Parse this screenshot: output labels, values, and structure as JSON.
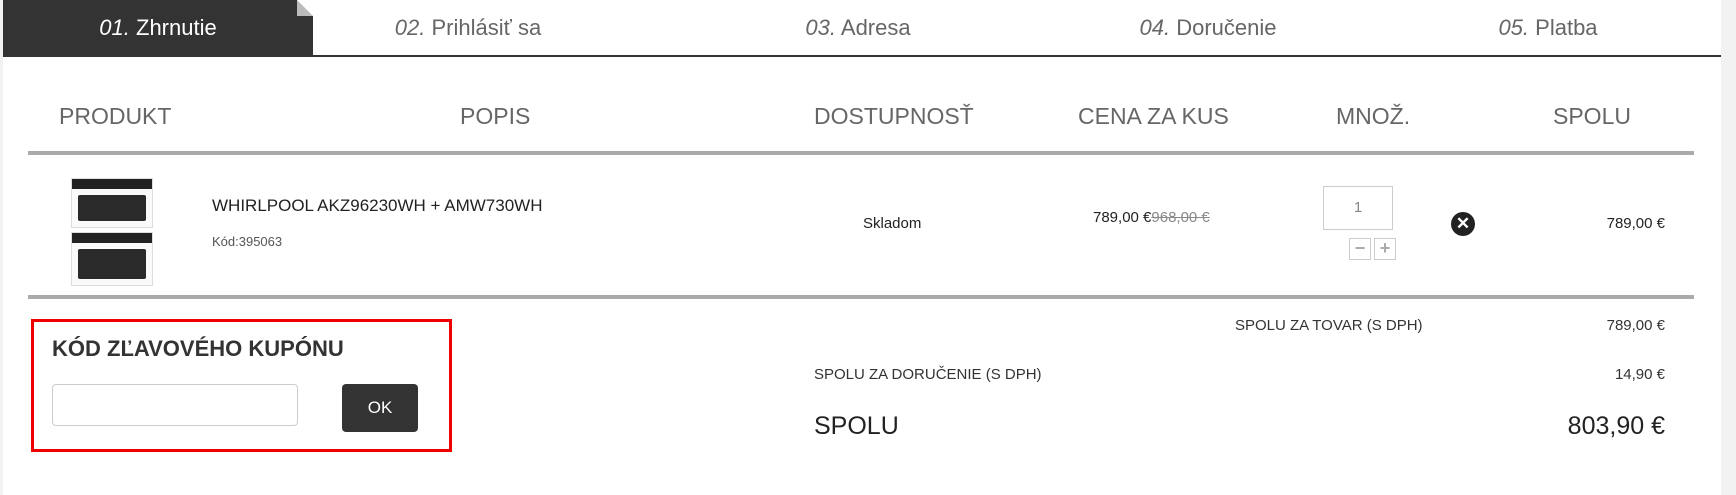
{
  "steps": [
    {
      "num": "01.",
      "label": "Zhrnutie"
    },
    {
      "num": "02.",
      "label": "Prihlásiť sa"
    },
    {
      "num": "03.",
      "label": "Adresa"
    },
    {
      "num": "04.",
      "label": "Doručenie"
    },
    {
      "num": "05.",
      "label": "Platba"
    }
  ],
  "table": {
    "headers": {
      "product": "PRODUKT",
      "description": "POPIS",
      "availability": "DOSTUPNOSŤ",
      "unit_price": "CENA ZA KUS",
      "quantity": "MNOŽ.",
      "total": "SPOLU"
    },
    "row": {
      "name": "WHIRLPOOL AKZ96230WH + AMW730WH",
      "code": "Kód:395063",
      "availability": "Skladom",
      "price": "789,00 €",
      "old_price": "968,00 €",
      "quantity": "1",
      "qty_minus": "−",
      "qty_plus": "+",
      "remove": "✕",
      "total": "789,00 €"
    }
  },
  "coupon": {
    "title": "KÓD ZĽAVOVÉHO KUPÓNU",
    "input_value": "",
    "button": "OK"
  },
  "totals": {
    "goods_label": "SPOLU ZA TOVAR (S DPH)",
    "goods_value": "789,00 €",
    "delivery_label": "SPOLU ZA DORUČENIE (S DPH)",
    "delivery_value": "14,90 €",
    "grand_label": "SPOLU",
    "grand_value": "803,90 €"
  },
  "colors": {
    "dark": "#333333",
    "highlight": "#ee0000"
  }
}
